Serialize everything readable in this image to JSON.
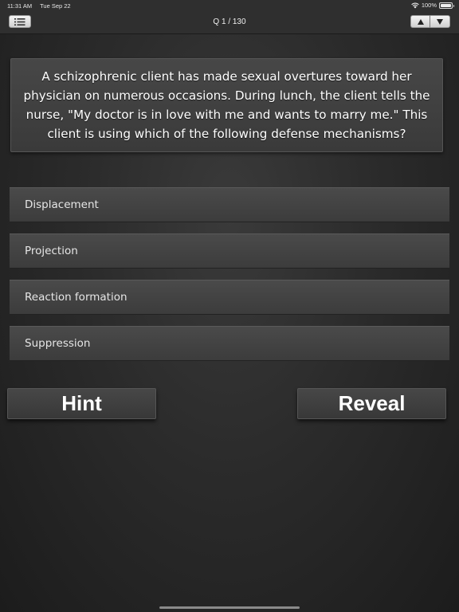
{
  "status_bar": {
    "time": "11:31 AM",
    "date": "Tue Sep 22",
    "battery": "100%"
  },
  "nav": {
    "counter": "Q 1 / 130"
  },
  "question": {
    "text": "A schizophrenic client has made sexual overtures toward her physician on numerous occasions. During lunch, the client tells the nurse, \"My doctor is in love with me and wants to marry me.\" This client is using which of the following defense mechanisms?"
  },
  "answers": [
    {
      "label": "Displacement"
    },
    {
      "label": "Projection"
    },
    {
      "label": "Reaction formation"
    },
    {
      "label": "Suppression"
    }
  ],
  "actions": {
    "hint_label": "Hint",
    "reveal_label": "Reveal"
  },
  "icons": {
    "menu": "list-icon",
    "prev": "triangle-up-icon",
    "next": "triangle-down-icon"
  }
}
